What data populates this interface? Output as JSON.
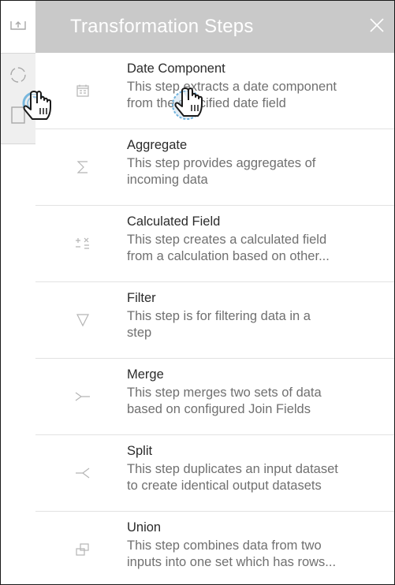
{
  "panel": {
    "title": "Transformation Steps"
  },
  "rail": {
    "top_icon": "upload-tray-icon",
    "active_icon": "refresh-circle-icon"
  },
  "steps": [
    {
      "name": "Date Component",
      "desc1": "This step extracts a date component",
      "desc2": "from the specified date field",
      "icon": "calendar-icon"
    },
    {
      "name": "Aggregate",
      "desc1": "This step provides aggregates of",
      "desc2": "incoming data",
      "icon": "sigma-icon"
    },
    {
      "name": "Calculated Field",
      "desc1": "This step creates a calculated field",
      "desc2": "from a calculation based on other...",
      "icon": "calculator-icon"
    },
    {
      "name": "Filter",
      "desc1": "This step is for filtering data in a",
      "desc2": "step",
      "icon": "filter-icon"
    },
    {
      "name": "Merge",
      "desc1": "This step merges two sets of data",
      "desc2": "based on configured Join Fields",
      "icon": "merge-icon"
    },
    {
      "name": "Split",
      "desc1": "This step duplicates an input dataset",
      "desc2": "to create identical output datasets",
      "icon": "split-icon"
    },
    {
      "name": "Union",
      "desc1": "This step combines data from two",
      "desc2": "inputs into one set which has rows...",
      "icon": "union-icon"
    }
  ],
  "colors": {
    "header_bg": "#c9c9c9",
    "icon_gray": "#b5b5b5",
    "cursor_ring": "#5aa9d8"
  }
}
